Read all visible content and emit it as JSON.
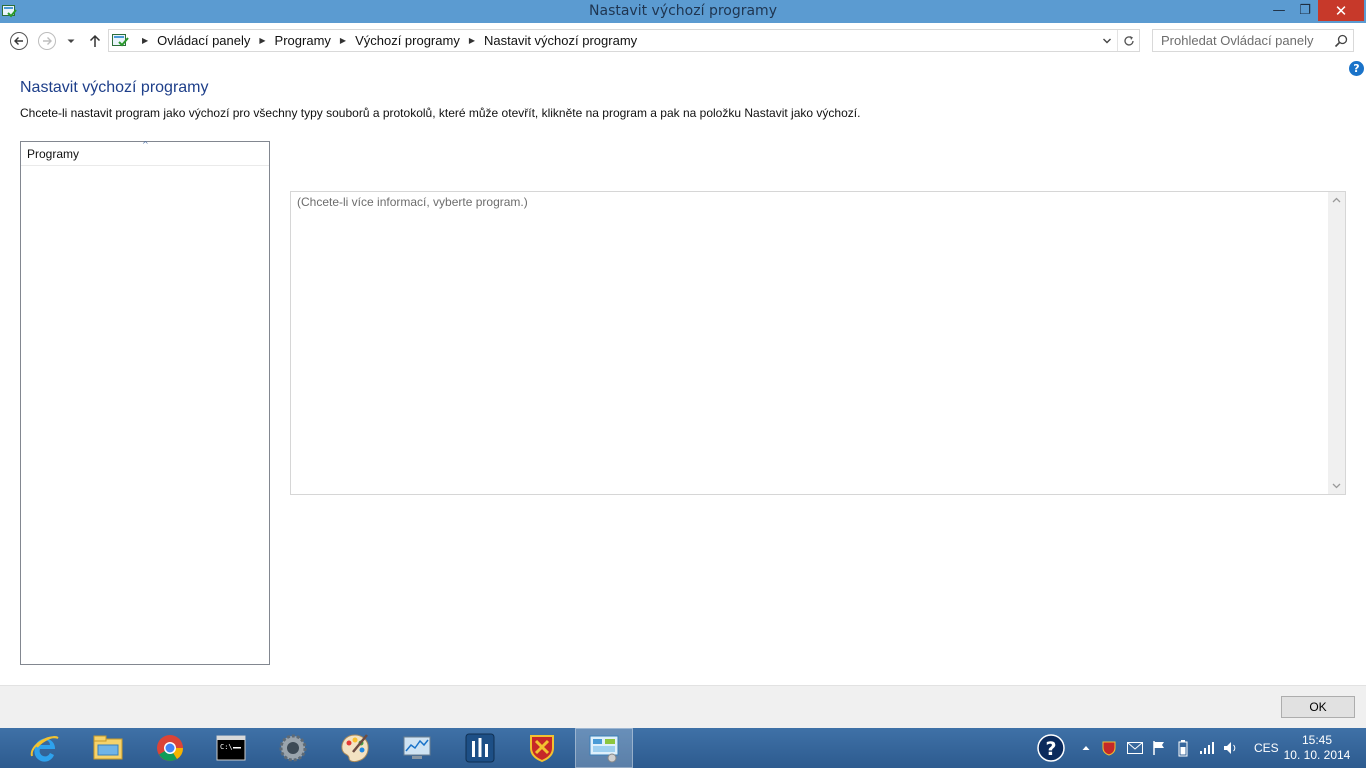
{
  "window": {
    "title": "Nastavit výchozí programy",
    "minimize_glyph": "—",
    "maximize_glyph": "❐",
    "close_glyph": "✕"
  },
  "navigation": {
    "breadcrumbs": [
      "Ovládací panely",
      "Programy",
      "Výchozí programy",
      "Nastavit výchozí programy"
    ],
    "separator_glyph": "▶",
    "search_placeholder": "Prohledat Ovládací panely"
  },
  "help": {
    "glyph": "?"
  },
  "content": {
    "heading": "Nastavit výchozí programy",
    "instruction": "Chcete-li nastavit program jako výchozí pro všechny typy souborů a protokolů, které může otevřít, klikněte na program a pak na položku Nastavit jako výchozí.",
    "programs_list": {
      "column_header": "Programy",
      "sort_glyph": "^",
      "items": []
    },
    "info_placeholder": "(Chcete-li více informací, vyberte program.)"
  },
  "footer": {
    "ok_label": "OK"
  },
  "taskbar": {
    "pinned": [
      {
        "name": "internet-explorer-icon"
      },
      {
        "name": "file-explorer-icon"
      },
      {
        "name": "chrome-icon"
      },
      {
        "name": "command-prompt-icon"
      },
      {
        "name": "settings-gear-app-icon"
      },
      {
        "name": "paint-palette-icon"
      },
      {
        "name": "performance-monitor-icon"
      },
      {
        "name": "equalizer-app-icon"
      },
      {
        "name": "coat-of-arms-app-icon"
      },
      {
        "name": "control-panel-icon",
        "active": true
      }
    ],
    "tray": {
      "language": "CES",
      "time": "15:45",
      "date": "10. 10. 2014"
    }
  },
  "colors": {
    "titlebar": "#5b9bd1",
    "close_button": "#c7392a",
    "heading": "#1e3f8a",
    "taskbar": "#3a6aa0"
  }
}
